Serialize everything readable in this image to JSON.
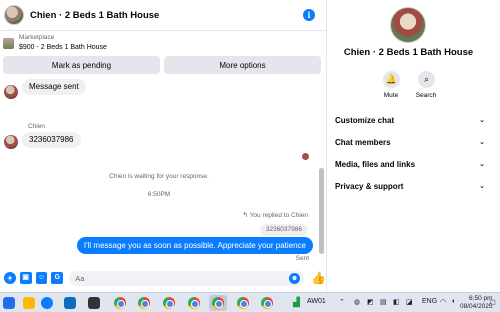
{
  "chat": {
    "title": "Chien · 2 Beds 1 Bath House",
    "info_icon": "info-icon",
    "marketplace_label": "Marketplace",
    "listing": "$900 - 2 Beds 1 Bath House",
    "actions": {
      "mark_pending": "Mark as pending",
      "more_options": "More options"
    },
    "messages": {
      "first_in": "Message sent",
      "sender_name": "Chien",
      "phone_in": "3236037986",
      "waiting": "Chien is waiting for your response.",
      "time": "6:50PM",
      "replied_to": "You replied to Chien",
      "quoted": "3236037986",
      "out": "I'll message you as soon as possible. Appreciate your patience",
      "status": "Sent"
    },
    "composer": {
      "placeholder": "Aa"
    }
  },
  "info_panel": {
    "title": "Chien · 2 Beds 1 Bath House",
    "mute_label": "Mute",
    "search_label": "Search",
    "menu": [
      {
        "label": "Customize chat"
      },
      {
        "label": "Chat members"
      },
      {
        "label": "Media, files and links"
      },
      {
        "label": "Privacy & support"
      }
    ]
  },
  "taskbar": {
    "ticker": "AW01",
    "language": "ENG",
    "time": "6:50 pm",
    "date": "08/04/2025"
  },
  "colors": {
    "accent": "#0a7cff",
    "bubble_in": "#f0f0f0",
    "taskbar": "#dfe6f0"
  }
}
